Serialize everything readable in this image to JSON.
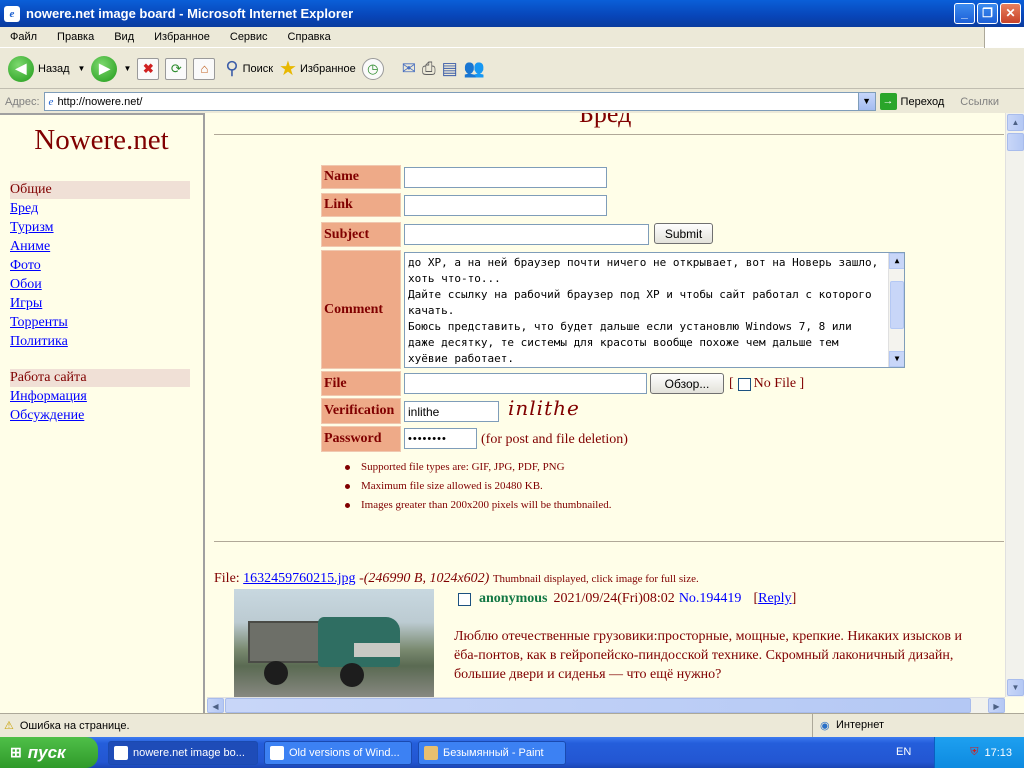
{
  "window": {
    "title": "nowere.net image board - Microsoft Internet Explorer"
  },
  "menu": [
    "Файл",
    "Правка",
    "Вид",
    "Избранное",
    "Сервис",
    "Справка"
  ],
  "toolbar": {
    "back": "Назад",
    "search": "Поиск",
    "favorites": "Избранное"
  },
  "address": {
    "label": "Адрес:",
    "url": "http://nowere.net/",
    "go": "Переход",
    "links": "Ссылки"
  },
  "sidebar": {
    "site_title": "Nowere.net",
    "groups": [
      {
        "head": "Общие",
        "items": [
          "Бред",
          "Туризм",
          "Аниме",
          "Фото",
          "Обои",
          "Игры",
          "Торренты",
          "Политика"
        ]
      },
      {
        "head": "Работа сайта",
        "items": [
          "Информация",
          "Обсуждение"
        ]
      }
    ]
  },
  "board": {
    "title": "Бред"
  },
  "form": {
    "name_label": "Name",
    "link_label": "Link",
    "subject_label": "Subject",
    "submit": "Submit",
    "comment_label": "Comment",
    "comment_value": "до XP, а на ней браузер почти ничего не открывает, вот на Новерь зашло, хоть что-то...\nДайте ссылку на рабочий браузер под XP и чтобы сайт работал с которого качать.\nБоюсь представить, что будет дальше если установлю Windows 7, 8 или даже десятку, те системы для красоты вообще похоже чем дальше тем хуёвие работает.",
    "file_label": "File",
    "browse": "Обзор...",
    "nofile_open": "[",
    "nofile": "No File ]",
    "verification_label": "Verification",
    "verification_value": "inlithe",
    "captcha": "inlithe",
    "password_label": "Password",
    "password_value": "••••••••",
    "password_note": "(for post and file deletion)",
    "rules": [
      "Supported file types are: GIF, JPG, PDF, PNG",
      "Maximum file size allowed is 20480 KB.",
      "Images greater than 200x200 pixels will be thumbnailed."
    ]
  },
  "post": {
    "file_prefix": "File:",
    "file_name": "1632459760215.jpg",
    "file_meta": "-(246990 B, 1024x602)",
    "thumb_note": "Thumbnail displayed, click image for full size.",
    "author": "anonymous",
    "date": "2021/09/24(Fri)08:02",
    "number": "No.194419",
    "reply_open": "[",
    "reply": "Reply",
    "reply_close": "]",
    "text": "Люблю отечественные грузовики:просторные, мощные, крепкие. Никаких изысков и ёба-понтов, как в гейропейско-пиндосской технике. Скромный лаконичный дизайн, большие двери и сиденья — что ещё нужно?"
  },
  "status": {
    "error": "Ошибка на странице.",
    "zone": "Интернет"
  },
  "taskbar": {
    "start": "пуск",
    "tasks": [
      "nowere.net image bo...",
      "Old versions of Wind...",
      "Безымянный - Paint"
    ],
    "lang": "EN",
    "clock": "17:13"
  }
}
